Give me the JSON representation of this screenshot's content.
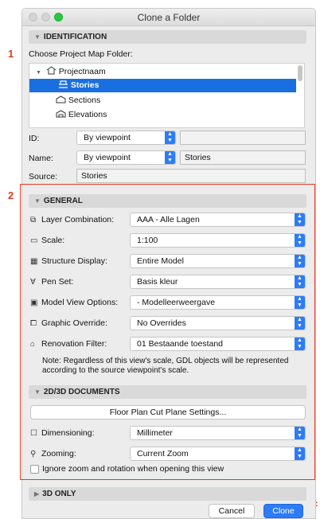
{
  "annotations": [
    "1",
    "2",
    ":"
  ],
  "window": {
    "title": "Clone a Folder"
  },
  "identification": {
    "header": "IDENTIFICATION",
    "choose_label": "Choose Project Map Folder:",
    "tree": [
      {
        "label": "Projectnaam",
        "icon": "house-icon"
      },
      {
        "label": "Stories",
        "icon": "stories-icon",
        "selected": true
      },
      {
        "label": "Sections",
        "icon": "section-icon"
      },
      {
        "label": "Elevations",
        "icon": "elevation-icon"
      }
    ],
    "id_label": "ID:",
    "id_mode": "By viewpoint",
    "id_value": "",
    "name_label": "Name:",
    "name_mode": "By viewpoint",
    "name_value": "Stories",
    "source_label": "Source:",
    "source_value": "Stories"
  },
  "general": {
    "header": "GENERAL",
    "rows": [
      {
        "label": "Layer Combination:",
        "value": "AAA - Alle Lagen",
        "icon": "layers-icon"
      },
      {
        "label": "Scale:",
        "value": "1:100",
        "icon": "ruler-icon"
      },
      {
        "label": "Structure Display:",
        "value": "Entire Model",
        "icon": "structure-icon"
      },
      {
        "label": "Pen Set:",
        "value": "Basis kleur",
        "icon": "pen-icon"
      },
      {
        "label": "Model View Options:",
        "value": "- Modelleerweergave",
        "icon": "model-view-icon"
      },
      {
        "label": "Graphic Override:",
        "value": "No Overrides",
        "icon": "override-icon"
      },
      {
        "label": "Renovation Filter:",
        "value": "01 Bestaande toestand",
        "icon": "renovation-icon"
      }
    ],
    "note": "Note: Regardless of this view's scale, GDL objects will be represented according to the source viewpoint's scale."
  },
  "docs": {
    "header": "2D/3D DOCUMENTS",
    "cut_plane_button": "Floor Plan Cut Plane Settings...",
    "dimensioning_label": "Dimensioning:",
    "dimensioning_value": "Millimeter",
    "zooming_label": "Zooming:",
    "zooming_value": "Current Zoom",
    "ignore_label": "Ignore zoom and rotation when opening this view"
  },
  "only3d": {
    "header": "3D ONLY"
  },
  "footer": {
    "cancel": "Cancel",
    "clone": "Clone"
  },
  "colors": {
    "accent": "#2d7cf6",
    "selection": "#1a6fe0",
    "annotation": "#e53a22"
  }
}
